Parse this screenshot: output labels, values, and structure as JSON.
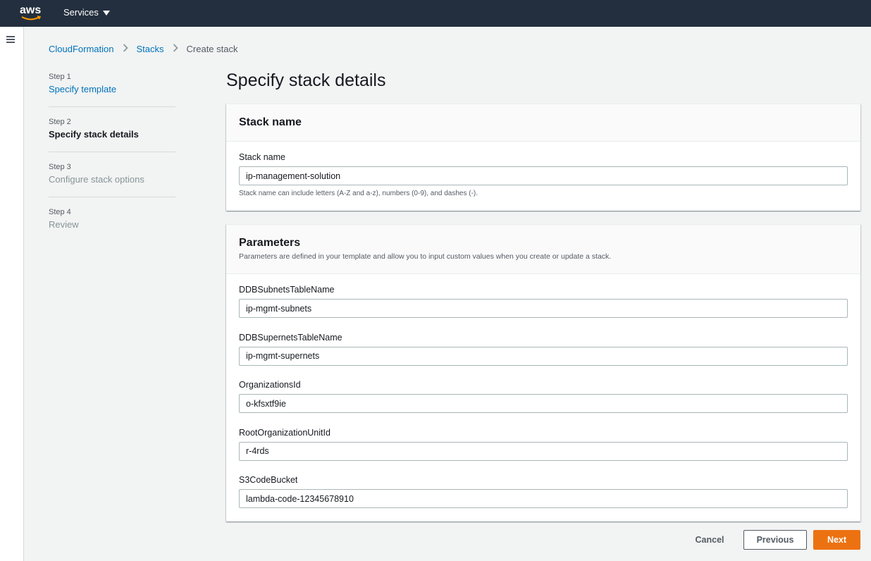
{
  "topbar": {
    "logo_text": "aws",
    "services_label": "Services",
    "services_icon": "caret-down-icon"
  },
  "sidebar": {
    "menu_icon": "hamburger-icon"
  },
  "breadcrumb": {
    "items": [
      "CloudFormation",
      "Stacks",
      "Create stack"
    ],
    "separator_icon": "chevron-right-icon"
  },
  "steps": [
    {
      "number": "Step 1",
      "label": "Specify template",
      "state": "completed"
    },
    {
      "number": "Step 2",
      "label": "Specify stack details",
      "state": "active"
    },
    {
      "number": "Step 3",
      "label": "Configure stack options",
      "state": "disabled"
    },
    {
      "number": "Step 4",
      "label": "Review",
      "state": "disabled"
    }
  ],
  "page": {
    "title": "Specify stack details"
  },
  "stack_name_section": {
    "title": "Stack name",
    "field_label": "Stack name",
    "value": "ip-management-solution",
    "hint": "Stack name can include letters (A-Z and a-z), numbers (0-9), and dashes (-)."
  },
  "parameters_section": {
    "title": "Parameters",
    "description": "Parameters are defined in your template and allow you to input custom values when you create or update a stack.",
    "fields": [
      {
        "label": "DDBSubnetsTableName",
        "value": "ip-mgmt-subnets"
      },
      {
        "label": "DDBSupernetsTableName",
        "value": "ip-mgmt-supernets"
      },
      {
        "label": "OrganizationsId",
        "value": "o-kfsxtf9ie"
      },
      {
        "label": "RootOrganizationUnitId",
        "value": "r-4rds"
      },
      {
        "label": "S3CodeBucket",
        "value": "lambda-code-12345678910"
      }
    ]
  },
  "actions": {
    "cancel": "Cancel",
    "previous": "Previous",
    "next": "Next"
  },
  "colors": {
    "topbar": "#232f3e",
    "link": "#0073bb",
    "primary": "#ec7211"
  }
}
